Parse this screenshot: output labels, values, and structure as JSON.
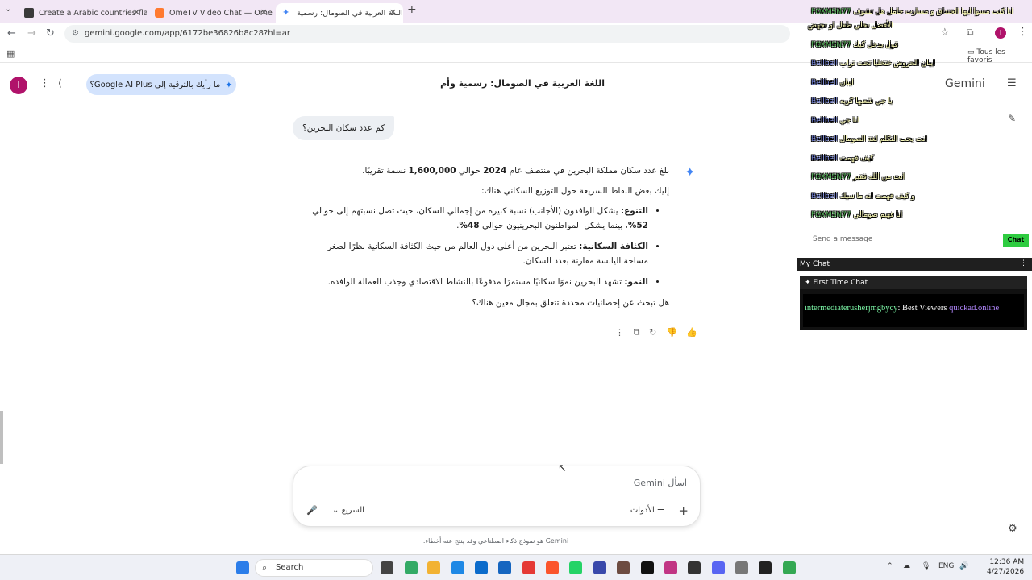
{
  "browser": {
    "tabs": [
      {
        "title": "Create a Arabic countries flags",
        "active": false
      },
      {
        "title": "OmeTV Video Chat — Ome",
        "active": false
      },
      {
        "title": "اللغة العربية في الصومال: رسمية",
        "active": true
      }
    ],
    "url": "gemini.google.com/app/6172be36826b8c28?hl=ar",
    "bookmarks_all": "Tous les favoris",
    "profile_initial": "I"
  },
  "gemini": {
    "brand": "Gemini",
    "conversation_title": "اللغة العربية في الصومال: رسمية وأم",
    "upgrade_label": "ما رأيك بالترقية إلى Google AI Plus؟",
    "avatar_initial": "I",
    "user_message": "كم عدد سكان البحرين؟",
    "answer": {
      "intro": [
        "بلغ عدد سكان مملكة البحرين في منتصف عام ",
        "2024",
        " حوالي ",
        "1,600,000",
        " نسمة تقريبًا."
      ],
      "lead": "إليك بعض النقاط السريعة حول التوزيع السكاني هناك:",
      "bullets": [
        {
          "title": "التنوع:",
          "pre": " يشكل الوافدون (الأجانب) نسبة كبيرة من إجمالي السكان، حيث تصل نسبتهم إلى حوالي ",
          "num1": "52%",
          "mid": "، بينما يشكل المواطنون البحرينيون حوالي ",
          "num2": "48%",
          "post": "."
        },
        {
          "title": "الكثافة السكانية:",
          "text": " تعتبر البحرين من أعلى دول العالم من حيث الكثافة السكانية نظرًا لصغر مساحة اليابسة مقارنة بعدد السكان."
        },
        {
          "title": "النمو:",
          "text": " تشهد البحرين نموًا سكانيًا مستمرًا مدفوعًا بالنشاط الاقتصادي وجذب العمالة الوافدة."
        }
      ],
      "followup": "هل تبحث عن إحصائيات محددة تتعلق بمجال معين هناك؟"
    },
    "prompt": {
      "placeholder": "اسأل Gemini",
      "tools_label": "الأدوات",
      "model_label": "السريع"
    },
    "disclaimer": "Gemini هو نموذج ذكاء اصطناعي وقد ينتج عنه أخطاء."
  },
  "overlay": {
    "messages": [
      {
        "name": "FOXMSN77",
        "text": "انا كنت مسوا ليها الخنداق و مسارت حامل هل تشوف"
      },
      {
        "name": "",
        "text": "الأفضل نخلي طفل او تجهض"
      },
      {
        "name": "FOXMSN77",
        "text": "قول يدخل كيك"
      },
      {
        "name": "Bellbell",
        "text": "ايبان الحروض ختخليا تحت تراب"
      },
      {
        "name": "Bellbell",
        "text": "ايبان"
      },
      {
        "name": "Bellbell",
        "text": "يا جي شعبها كريه"
      },
      {
        "name": "Bellbell",
        "text": "انا جي"
      },
      {
        "name": "Bellbell",
        "text": "انت يحب التكلم لغة الصومال"
      },
      {
        "name": "Bellbell",
        "text": "كيف فهمت"
      },
      {
        "name": "FOXMSN77",
        "text": "انت من الله فقير"
      },
      {
        "name": "Bellbell",
        "text": "و كيف فهمت انه ما سيك"
      },
      {
        "name": "FOXMSN77",
        "text": "انا فهيم صومالي"
      }
    ],
    "send_placeholder": "Send a message",
    "chat_button": "Chat",
    "my_chat_title": "My Chat",
    "first_time_chat": "First Time Chat",
    "ftc_user": "intermediaterusherjmgbycy",
    "ftc_message": ": Best Viewers ",
    "ftc_site": "quickad.online"
  },
  "taskbar": {
    "search_label": "Search",
    "language": "ENG",
    "time": "12:36 AM",
    "date": "4/27/2026"
  }
}
